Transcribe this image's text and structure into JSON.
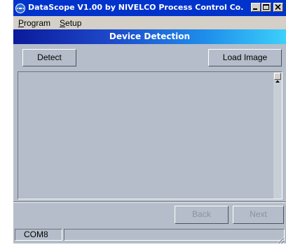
{
  "window": {
    "title": "DataScope V1.00 by NIVELCO Process Control Co."
  },
  "menu": {
    "items": [
      {
        "mnemonic": "P",
        "rest": "rogram"
      },
      {
        "mnemonic": "S",
        "rest": "etup"
      }
    ]
  },
  "header": {
    "title": "Device Detection"
  },
  "toolbar": {
    "detect_label": "Detect",
    "load_image_label": "Load Image"
  },
  "navigation": {
    "back_label": "Back",
    "next_label": "Next",
    "back_enabled": false,
    "next_enabled": false
  },
  "status": {
    "port": "COM8",
    "message": ""
  },
  "colors": {
    "titlebar": "#0033cc",
    "window_bg": "#b4bdc9",
    "header_gradient_start": "#0b1a9c",
    "header_gradient_end": "#3cd0fb"
  },
  "icons": {
    "app": "datascope-app-icon",
    "minimize": "minimize-icon",
    "maximize": "maximize-icon",
    "close": "close-icon",
    "scroll_up": "scroll-up-arrow-icon",
    "resize_grip": "resize-grip-icon"
  }
}
